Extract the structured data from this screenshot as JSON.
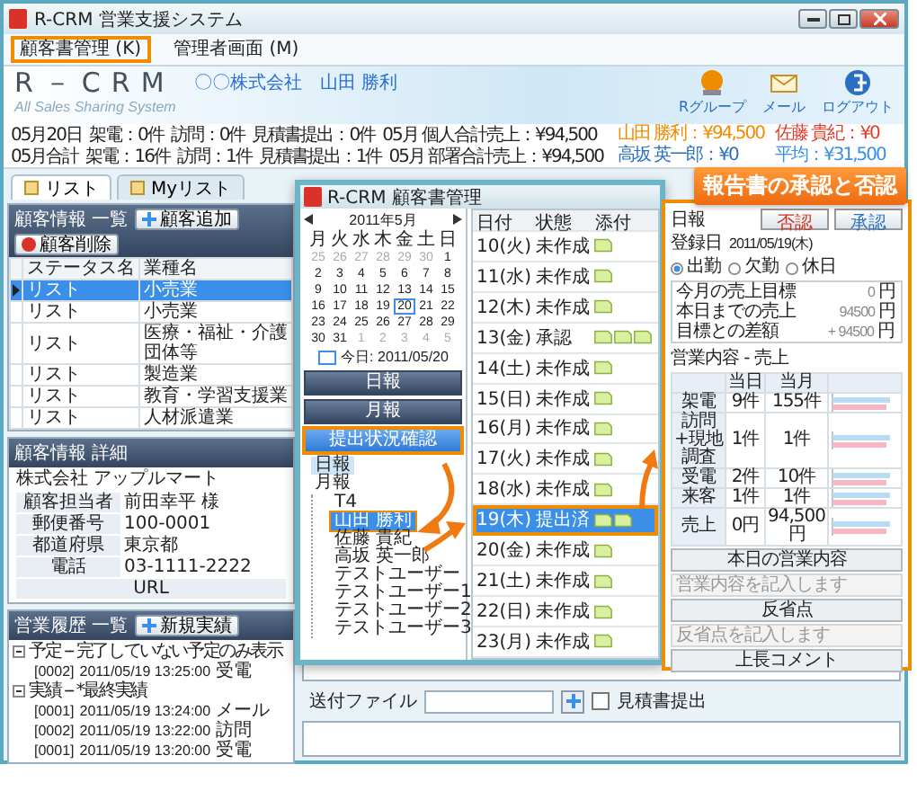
{
  "window": {
    "title": "R-CRM 営業支援システム"
  },
  "menu": [
    {
      "label": "顧客書管理 (K)",
      "highlighted": true
    },
    {
      "label": "管理者画面 (M)",
      "highlighted": false
    }
  ],
  "header": {
    "logo": "R－CRM",
    "tagline": "All Sales Sharing System",
    "company": "〇〇株式会社",
    "user": "山田 勝利",
    "tools": [
      {
        "label": "Rグループ",
        "kind": "group"
      },
      {
        "label": "メール",
        "kind": "mail"
      },
      {
        "label": "ログアウト",
        "kind": "logout"
      }
    ]
  },
  "stats": [
    {
      "cells": [
        "05月20日",
        "架電：0件",
        "訪問：0件",
        "見積書提出：0件",
        "05月 個人合計売上：¥94,500"
      ]
    },
    {
      "cells": [
        "05月合計",
        "架電：16件",
        "訪問：1件",
        "見積書提出：1件",
        "05月 部署合計売上：¥94,500"
      ]
    }
  ],
  "ranking": [
    {
      "text": "山田 勝利：¥94,500",
      "color": "#f08c00"
    },
    {
      "text": "佐藤 貴紀：¥0",
      "color": "#e03c28"
    },
    {
      "text": "高坂 英一郎：¥0",
      "color": "#2a6fc0"
    },
    {
      "text": "平均：¥31,500",
      "color": "#3a8ee6"
    }
  ],
  "tabs": [
    {
      "label": "リスト",
      "selected": true
    },
    {
      "label": "Myリスト",
      "selected": false
    }
  ],
  "customer_list": {
    "title": "顧客情報 一覧",
    "buttons": [
      {
        "label": "顧客追加",
        "kind": "add"
      },
      {
        "label": "顧客削除",
        "kind": "delete"
      }
    ],
    "columns": [
      "ステータス名",
      "業種名"
    ],
    "rows": [
      {
        "cells": [
          "リスト",
          "小売業"
        ],
        "selected": true
      },
      {
        "cells": [
          "リスト",
          "小売業"
        ],
        "selected": false
      },
      {
        "cells": [
          "リスト",
          "医療・福祉・介護団体等"
        ],
        "selected": false
      },
      {
        "cells": [
          "リスト",
          "製造業"
        ],
        "selected": false
      },
      {
        "cells": [
          "リスト",
          "教育・学習支援業"
        ],
        "selected": false
      },
      {
        "cells": [
          "リスト",
          "人材派遣業"
        ],
        "selected": false
      }
    ]
  },
  "customer_detail": {
    "title": "顧客情報 詳細",
    "company": "株式会社 アップルマート",
    "fields": [
      {
        "label": "顧客担当者",
        "value": "前田幸平 様"
      },
      {
        "label": "郵便番号",
        "value": "100-0001"
      },
      {
        "label": "都道府県",
        "value": "東京都"
      },
      {
        "label": "電話",
        "value": "03-1111-2222"
      },
      {
        "label": "URL"
      }
    ]
  },
  "sales_history": {
    "title": "営業履歴 一覧",
    "button": "新規実績",
    "groups": [
      {
        "label": "予定 -- 完了していない予定のみ表示",
        "expanded": true,
        "children": [
          {
            "code": "[0002]",
            "time": "2011/05/19 13:25:00",
            "type": "受電"
          }
        ]
      },
      {
        "label": "実績 -- *最終実績",
        "expanded": true,
        "children": [
          {
            "code": "[0001]",
            "time": "2011/05/19 13:24:00",
            "type": "メール"
          },
          {
            "code": "[0002]",
            "time": "2011/05/19 13:22:00",
            "type": "訪問"
          },
          {
            "code": "[0001]",
            "time": "2011/05/19 13:20:00",
            "type": "受電"
          }
        ]
      }
    ]
  },
  "attachment_bar": {
    "label": "送付ファイル",
    "checkbox": {
      "label": "見積書提出",
      "checked": false
    }
  },
  "dialog": {
    "title": "R-CRM 顧客書管理",
    "calendar": {
      "month": "2011年5月",
      "weekdays": [
        "月",
        "火",
        "水",
        "木",
        "金",
        "土",
        "日"
      ],
      "days": [
        {
          "day": "25",
          "muted": true,
          "selected": false
        },
        {
          "day": "26",
          "muted": true,
          "selected": false
        },
        {
          "day": "27",
          "muted": true,
          "selected": false
        },
        {
          "day": "28",
          "muted": true,
          "selected": false
        },
        {
          "day": "29",
          "muted": true,
          "selected": false
        },
        {
          "day": "30",
          "muted": true,
          "selected": false
        },
        {
          "day": "1",
          "muted": false,
          "selected": false
        },
        {
          "day": "2",
          "muted": false,
          "selected": false
        },
        {
          "day": "3",
          "muted": false,
          "selected": false
        },
        {
          "day": "4",
          "muted": false,
          "selected": false
        },
        {
          "day": "5",
          "muted": false,
          "selected": false
        },
        {
          "day": "6",
          "muted": false,
          "selected": false
        },
        {
          "day": "7",
          "muted": false,
          "selected": false
        },
        {
          "day": "8",
          "muted": false,
          "selected": false
        },
        {
          "day": "9",
          "muted": false,
          "selected": false
        },
        {
          "day": "10",
          "muted": false,
          "selected": false
        },
        {
          "day": "11",
          "muted": false,
          "selected": false
        },
        {
          "day": "12",
          "muted": false,
          "selected": false
        },
        {
          "day": "13",
          "muted": false,
          "selected": false
        },
        {
          "day": "14",
          "muted": false,
          "selected": false
        },
        {
          "day": "15",
          "muted": false,
          "selected": false
        },
        {
          "day": "16",
          "muted": false,
          "selected": false
        },
        {
          "day": "17",
          "muted": false,
          "selected": false
        },
        {
          "day": "18",
          "muted": false,
          "selected": false
        },
        {
          "day": "19",
          "muted": false,
          "selected": false
        },
        {
          "day": "20",
          "muted": false,
          "selected": true
        },
        {
          "day": "21",
          "muted": false,
          "selected": false
        },
        {
          "day": "22",
          "muted": false,
          "selected": false
        },
        {
          "day": "23",
          "muted": false,
          "selected": false
        },
        {
          "day": "24",
          "muted": false,
          "selected": false
        },
        {
          "day": "25",
          "muted": false,
          "selected": false
        },
        {
          "day": "26",
          "muted": false,
          "selected": false
        },
        {
          "day": "27",
          "muted": false,
          "selected": false
        },
        {
          "day": "28",
          "muted": false,
          "selected": false
        },
        {
          "day": "29",
          "muted": false,
          "selected": false
        },
        {
          "day": "30",
          "muted": false,
          "selected": false
        },
        {
          "day": "31",
          "muted": false,
          "selected": false
        },
        {
          "day": "1",
          "muted": true,
          "selected": false
        },
        {
          "day": "2",
          "muted": true,
          "selected": false
        },
        {
          "day": "3",
          "muted": true,
          "selected": false
        },
        {
          "day": "4",
          "muted": true,
          "selected": false
        },
        {
          "day": "5",
          "muted": true,
          "selected": false
        }
      ],
      "today": "今日: 2011/05/20"
    },
    "nav_buttons": [
      {
        "label": "日報",
        "selected": false
      },
      {
        "label": "月報",
        "selected": false
      },
      {
        "label": "提出状況確認",
        "selected": true
      }
    ],
    "view_options": [
      {
        "label": "日報",
        "selected": true
      },
      {
        "label": "月報",
        "selected": false
      }
    ],
    "users": [
      {
        "name": "T4",
        "selected": false
      },
      {
        "name": "山田 勝利",
        "selected": true
      },
      {
        "name": "佐藤 貴紀",
        "selected": false
      },
      {
        "name": "高坂 英一郎",
        "selected": false
      },
      {
        "name": "テストユーザー",
        "selected": false
      },
      {
        "name": "テストユーザー1",
        "selected": false
      },
      {
        "name": "テストユーザー2",
        "selected": false
      },
      {
        "name": "テストユーザー3",
        "selected": false
      }
    ],
    "days": {
      "columns": [
        "日付",
        "状態",
        "添付"
      ],
      "rows": [
        {
          "date": "10(火)",
          "status": "未作成",
          "attachments": [
            {
              "kind": "memo"
            }
          ],
          "selected": false
        },
        {
          "date": "11(水)",
          "status": "未作成",
          "attachments": [
            {
              "kind": "memo"
            }
          ],
          "selected": false
        },
        {
          "date": "12(木)",
          "status": "未作成",
          "attachments": [
            {
              "kind": "memo"
            }
          ],
          "selected": false
        },
        {
          "date": "13(金)",
          "status": "承認",
          "attachments": [
            {
              "kind": "memo"
            },
            {
              "kind": "memo"
            },
            {
              "kind": "memo"
            }
          ],
          "selected": false
        },
        {
          "date": "14(土)",
          "status": "未作成",
          "attachments": [
            {
              "kind": "memo"
            }
          ],
          "selected": false
        },
        {
          "date": "15(日)",
          "status": "未作成",
          "attachments": [
            {
              "kind": "memo"
            }
          ],
          "selected": false
        },
        {
          "date": "16(月)",
          "status": "未作成",
          "attachments": [
            {
              "kind": "memo"
            }
          ],
          "selected": false
        },
        {
          "date": "17(火)",
          "status": "未作成",
          "attachments": [
            {
              "kind": "memo"
            }
          ],
          "selected": false
        },
        {
          "date": "18(水)",
          "status": "未作成",
          "attachments": [
            {
              "kind": "memo"
            }
          ],
          "selected": false
        },
        {
          "date": "19(木)",
          "status": "提出済",
          "attachments": [
            {
              "kind": "memo"
            },
            {
              "kind": "memo"
            }
          ],
          "selected": true
        },
        {
          "date": "20(金)",
          "status": "未作成",
          "attachments": [
            {
              "kind": "memo"
            }
          ],
          "selected": false
        },
        {
          "date": "21(土)",
          "status": "未作成",
          "attachments": [
            {
              "kind": "memo"
            }
          ],
          "selected": false
        },
        {
          "date": "22(日)",
          "status": "未作成",
          "attachments": [
            {
              "kind": "memo"
            }
          ],
          "selected": false
        },
        {
          "date": "23(月)",
          "status": "未作成",
          "attachments": [
            {
              "kind": "memo"
            }
          ],
          "selected": false
        }
      ]
    }
  },
  "report": {
    "callout": "報告書の承認と否認",
    "label": "日報",
    "buttons": [
      {
        "label": "否認",
        "kind": "reject"
      },
      {
        "label": "承認",
        "kind": "approve"
      }
    ],
    "date_label": "登録日",
    "date": "2011/05/19(木)",
    "attendance": [
      {
        "label": "出勤",
        "selected": true
      },
      {
        "label": "欠勤",
        "selected": false
      },
      {
        "label": "休日",
        "selected": false
      }
    ],
    "summary": [
      {
        "label": "今月の売上目標",
        "value": "0",
        "unit": "円"
      },
      {
        "label": "本日までの売上",
        "value": "94500",
        "unit": "円"
      },
      {
        "label": "目標との差額",
        "value": "+ 94500",
        "unit": "円"
      }
    ],
    "section": "営業内容 - 売上",
    "columns": [
      "当日",
      "当月"
    ],
    "rows": [
      {
        "label": "架電",
        "day": "9件",
        "month": "155件"
      },
      {
        "label": "訪問+現地調査",
        "day": "1件",
        "month": "1件"
      },
      {
        "label": "受電",
        "day": "2件",
        "month": "10件"
      },
      {
        "label": "来客",
        "day": "1件",
        "month": "1件"
      },
      {
        "label": "売上",
        "day": "0円",
        "month": "94,500円"
      }
    ],
    "notes": [
      {
        "title": "本日の営業内容",
        "placeholder": "営業内容を記入します"
      },
      {
        "title": "反省点",
        "placeholder": "反省点を記入します"
      },
      {
        "title": "上長コメント"
      }
    ]
  }
}
